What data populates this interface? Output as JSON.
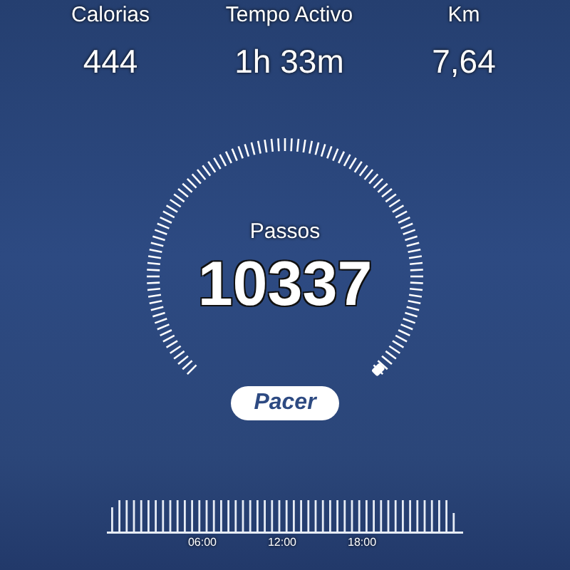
{
  "stats": [
    {
      "label": "Calorias",
      "value": "444"
    },
    {
      "label": "Tempo Activo",
      "value": "1h 33m"
    },
    {
      "label": "Km",
      "value": "7,64"
    }
  ],
  "steps": {
    "label": "Passos",
    "value": "10337"
  },
  "brand": {
    "label": "Pacer"
  },
  "timeline": {
    "labels": [
      "06:00",
      "12:00",
      "18:00"
    ]
  }
}
